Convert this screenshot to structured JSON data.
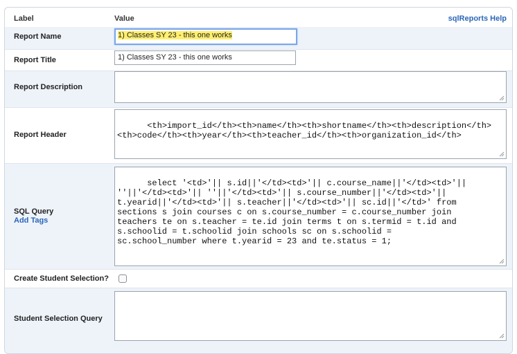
{
  "header": {
    "label_col": "Label",
    "value_col": "Value",
    "help_link": "sqlReports Help"
  },
  "fields": {
    "report_name": {
      "label": "Report Name",
      "value": "1) Classes SY 23 - this one works"
    },
    "report_title": {
      "label": "Report Title",
      "value": "1) Classes SY 23 - this one works"
    },
    "report_description": {
      "label": "Report Description",
      "value": ""
    },
    "report_header": {
      "label": "Report Header",
      "value": "<th>import_id</th><th>name</th><th>shortname</th><th>description</th>\n<th>code</th><th>year</th><th>teacher_id</th><th>organization_id</th>"
    },
    "sql_query": {
      "label": "SQL Query",
      "add_tags": "Add Tags",
      "value": "select '<td>'|| s.id||'</td><td>'|| c.course_name||'</td><td>'||\n''||'</td><td>'|| ''||'</td><td>'|| s.course_number||'</td><td>'||\nt.yearid||'</td><td>'|| s.teacher||'</td><td>'|| sc.id||'</td>' from\nsections s join courses c on s.course_number = c.course_number join\nteachers te on s.teacher = te.id join terms t on s.termid = t.id and\ns.schoolid = t.schoolid join schools sc on s.schoolid =\nsc.school_number where t.yearid = 23 and te.status = 1;"
    },
    "create_student_selection": {
      "label": "Create Student Selection?",
      "checked": false
    },
    "student_selection_query": {
      "label": "Student Selection Query",
      "value": ""
    }
  }
}
